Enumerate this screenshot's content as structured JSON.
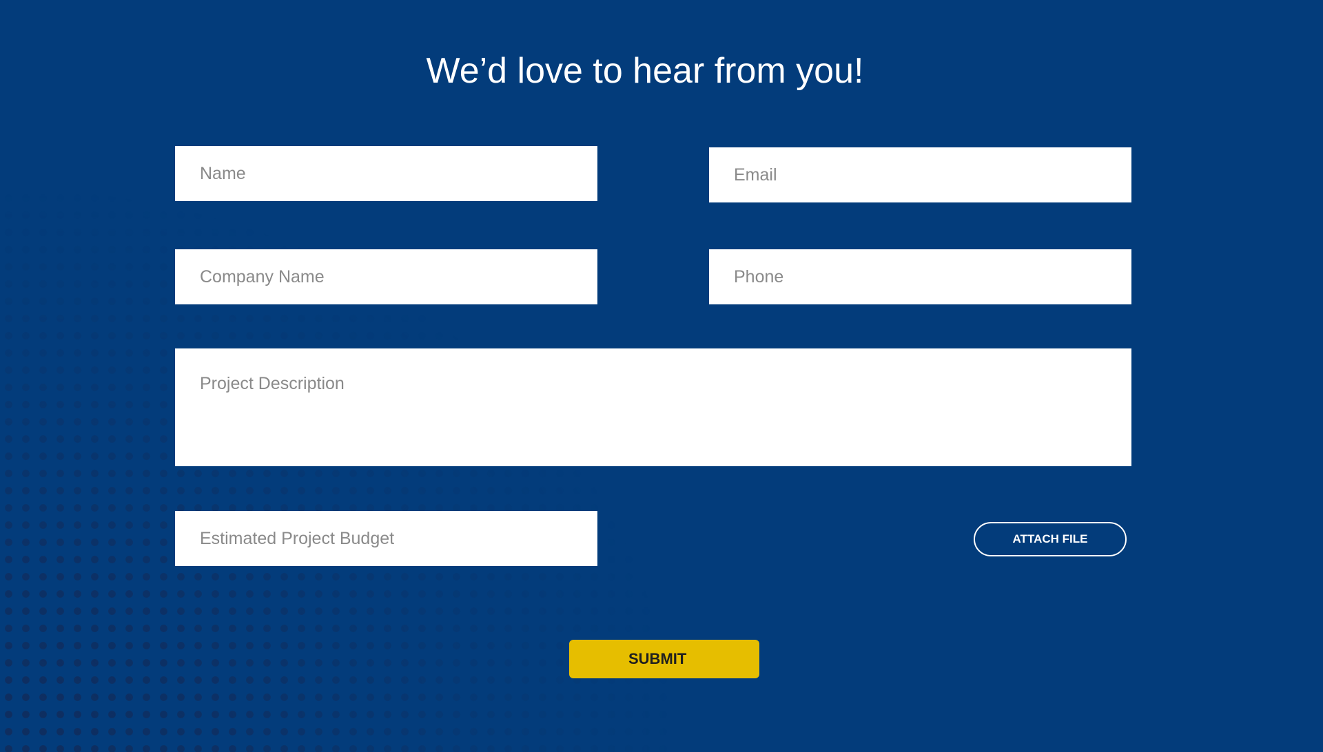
{
  "page": {
    "heading": "We’d love to hear from you!"
  },
  "form": {
    "name": {
      "placeholder": "Name",
      "value": ""
    },
    "email": {
      "placeholder": "Email",
      "value": ""
    },
    "company": {
      "placeholder": "Company Name",
      "value": ""
    },
    "phone": {
      "placeholder": "Phone",
      "value": ""
    },
    "description": {
      "placeholder": "Project Description",
      "value": ""
    },
    "budget": {
      "placeholder": "Estimated Project Budget",
      "value": ""
    },
    "attach_label": "ATTACH FILE",
    "submit_label": "SUBMIT"
  },
  "colors": {
    "background": "#033c7b",
    "dot_pattern": "#122b5a",
    "submit_button": "#e6be00",
    "field_background": "#ffffff",
    "placeholder_text": "#8a8a8a"
  }
}
